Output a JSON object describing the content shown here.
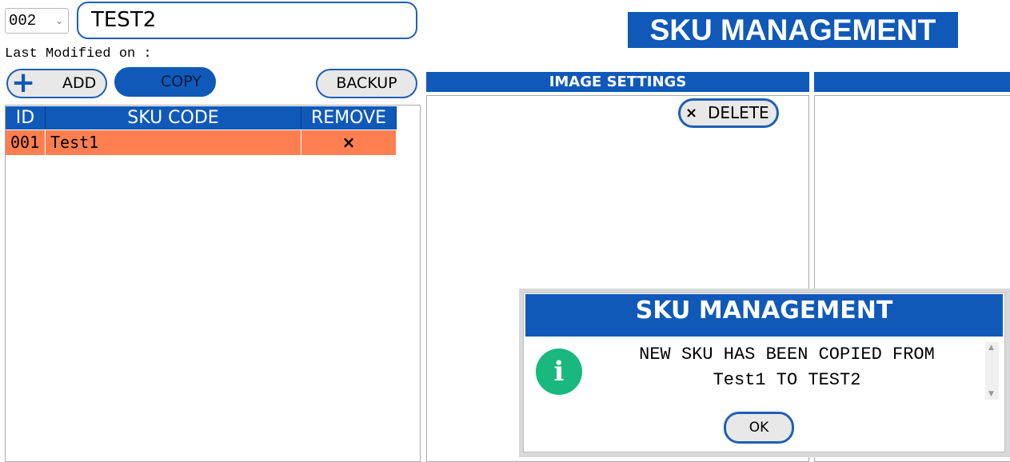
{
  "header": {
    "id_select": {
      "value": "002",
      "options": [
        "002"
      ]
    },
    "name_input": {
      "value": "TEST2"
    },
    "last_modified_label": "Last Modified on :",
    "title": "SKU MANAGEMENT"
  },
  "toolbar": {
    "add_label": "ADD",
    "copy_label": "COPY",
    "backup_label": "BACKUP"
  },
  "sku_table": {
    "columns": [
      "ID",
      "SKU CODE",
      "REMOVE"
    ],
    "rows": [
      {
        "id": "001",
        "sku_code": "Test1",
        "remove": "×"
      }
    ]
  },
  "image_settings": {
    "title": "IMAGE SETTINGS",
    "delete_label": "DELETE",
    "delete_icon": "×"
  },
  "dialog": {
    "title": "SKU MANAGEMENT",
    "icon": "i",
    "message": "NEW SKU HAS BEEN COPIED FROM\nTest1 TO TEST2",
    "ok_label": "OK"
  },
  "colors": {
    "accent_blue": "#1059b9",
    "row_highlight": "#ff7f50",
    "info_green": "#18b87e"
  }
}
